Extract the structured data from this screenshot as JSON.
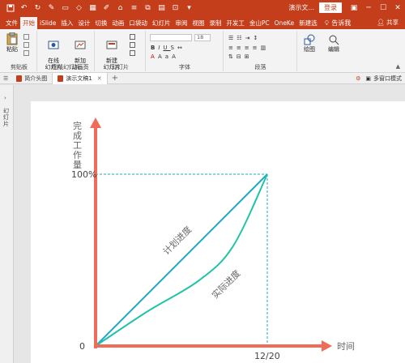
{
  "titlebar": {
    "doc_title": "演示文...",
    "login_label": "登录"
  },
  "tabs": [
    {
      "label": "文件"
    },
    {
      "label": "开始"
    },
    {
      "label": "iSlide"
    },
    {
      "label": "插入"
    },
    {
      "label": "设计"
    },
    {
      "label": "切换"
    },
    {
      "label": "动画"
    },
    {
      "label": "口袋动"
    },
    {
      "label": "幻灯片"
    },
    {
      "label": "审阅"
    },
    {
      "label": "视图"
    },
    {
      "label": "录制"
    },
    {
      "label": "开发工"
    },
    {
      "label": "金山PC"
    },
    {
      "label": "OneKe"
    },
    {
      "label": "新建选"
    }
  ],
  "help_label": "告诉我",
  "share_label": "共享",
  "ribbon": {
    "paste_label": "粘贴",
    "clipboard_label": "剪贴板",
    "online_slides_label": "在线\n幻灯片",
    "add_anim_label": "新加\n动画页",
    "online_group_label": "在线幻灯片",
    "new_slide_label": "新建\n幻灯片",
    "slides_group_label": "幻灯片",
    "font_size_value": "18",
    "font_group_label": "字体",
    "paragraph_group_label": "段落",
    "drawing_label": "绘图",
    "editing_label": "编辑"
  },
  "doctabs": {
    "tab1": "简介头图",
    "tab2": "演示文稿1",
    "multiwindow_label": "多窗口模式"
  },
  "sidepanel": {
    "label": "幻灯片"
  },
  "chart_data": {
    "type": "line",
    "ylabel": "完成工作量",
    "xlabel": "时间",
    "y_ticks": [
      "0",
      "100%"
    ],
    "x_ticks": [
      "12/20"
    ],
    "series": [
      {
        "name": "计划进度",
        "color": "#1fa7c9",
        "points": [
          [
            0,
            0
          ],
          [
            1,
            1
          ]
        ]
      },
      {
        "name": "实际进度",
        "color": "#1fc4a8",
        "points": [
          [
            0,
            0
          ],
          [
            0.3,
            0.2
          ],
          [
            0.6,
            0.38
          ],
          [
            0.8,
            0.58
          ],
          [
            1,
            1
          ]
        ]
      }
    ],
    "axis_color": "#f06b5a",
    "guide_color": "#1fa7c9"
  }
}
